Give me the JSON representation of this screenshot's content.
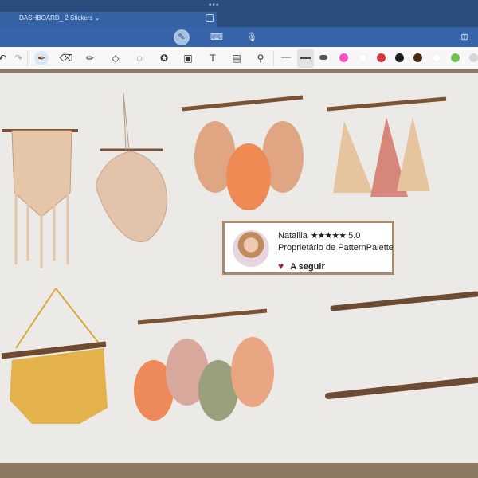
{
  "window": {
    "title": "DASHBOARD_ 2 Stickers",
    "more": "•••"
  },
  "icons": {
    "title_chevron": "chevron-down-icon",
    "split": "split-view-icon",
    "pen_mode": "pen-icon",
    "keyboard": "keyboard-icon",
    "mic": "microphone-icon",
    "add_page": "add-page-icon"
  },
  "toolbar": {
    "tools": [
      "undo",
      "redo",
      "pen",
      "eraser",
      "highlighter",
      "shapes",
      "lasso",
      "sticker",
      "image",
      "text",
      "scan",
      "magic"
    ],
    "colors": [
      "#ff4fc8",
      "#ffffff",
      "#d8373c",
      "#1b1b1b",
      "#4b2a12",
      "#ffffff",
      "#6cc24a",
      "#d5d5d5"
    ]
  },
  "card": {
    "name": "Nataliia",
    "stars": "★★★★★",
    "rating": "5.0",
    "subtitle": "Proprietário de PatternPalette",
    "follow": "A seguir"
  }
}
